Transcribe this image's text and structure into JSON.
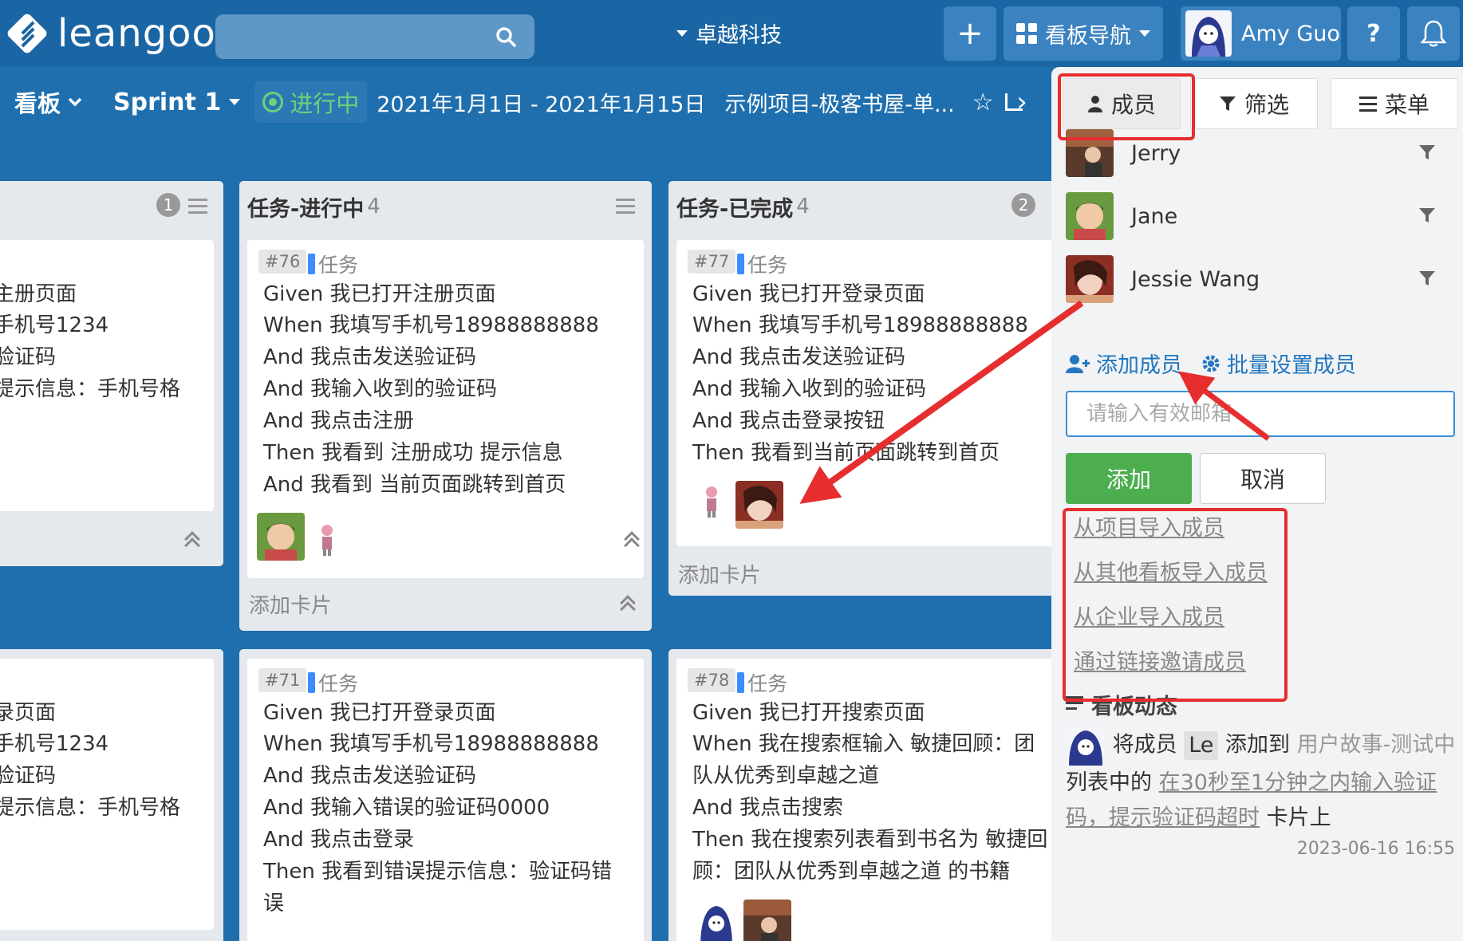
{
  "app": {
    "logo_text": "leangoo",
    "org_name": "卓越科技",
    "board_nav_label": "看板导航",
    "user_name": "Amy Guo",
    "help_label": "?"
  },
  "subheader": {
    "board_label": "看板",
    "sprint_label": "Sprint 1",
    "status_label": "进行中",
    "date_range": "2021年1月1日 - 2021年1月15日",
    "project_name": "示例项目-极客书屋-单..."
  },
  "lists": [
    {
      "title": "",
      "badge": "1",
      "cards": [
        {
          "lines": [
            "主册页面",
            "手机号1234",
            "验证码",
            "提示信息：手机号格"
          ]
        },
        {
          "lines": [
            "录页面",
            "手机号1234",
            "验证码",
            "提示信息：手机号格"
          ]
        }
      ]
    },
    {
      "title": "任务-进行中",
      "count": "4",
      "add_card": "添加卡片",
      "cards": [
        {
          "id": "#76",
          "type": "任务",
          "lines": [
            "Given 我已打开注册页面",
            "When 我填写手机号18988888888",
            "And 我点击发送验证码",
            "And 我输入收到的验证码",
            "And 我点击注册",
            "Then 我看到 注册成功 提示信息",
            "And 我看到 当前页面跳转到首页"
          ]
        },
        {
          "id": "#71",
          "type": "任务",
          "lines": [
            "Given 我已打开登录页面",
            "When 我填写手机号18988888888",
            "And 我点击发送验证码",
            "And 我输入错误的验证码0000",
            "And 我点击登录",
            "Then 我看到错误提示信息：验证码错",
            "误"
          ]
        }
      ]
    },
    {
      "title": "任务-已完成",
      "count": "4",
      "badge": "2",
      "add_card": "添加卡片",
      "cards": [
        {
          "id": "#77",
          "type": "任务",
          "lines": [
            "Given 我已打开登录页面",
            "When 我填写手机号18988888888",
            "And 我点击发送验证码",
            "And 我输入收到的验证码",
            "And 我点击登录按钮",
            "Then 我看到当前页面跳转到首页"
          ]
        },
        {
          "id": "#78",
          "type": "任务",
          "lines": [
            "Given 我已打开搜索页面",
            "When 我在搜索框输入 敏捷回顾：团",
            "队从优秀到卓越之道",
            "And 我点击搜索",
            "Then 我在搜索列表看到书名为 敏捷回",
            "顾：团队从优秀到卓越之道 的书籍"
          ]
        }
      ]
    }
  ],
  "panel": {
    "tabs": {
      "members": "成员",
      "filter": "筛选",
      "menu": "菜单"
    },
    "members": [
      {
        "name": "Jerry"
      },
      {
        "name": "Jane"
      },
      {
        "name": "Jessie Wang"
      }
    ],
    "add_member_label": "添加成员",
    "batch_setting_label": "批量设置成员",
    "email_placeholder": "请输入有效邮箱",
    "add_button": "添加",
    "cancel_button": "取消",
    "import_links": [
      "从项目导入成员",
      "从其他看板导入成员",
      "从企业导入成员",
      "通过链接邀请成员"
    ],
    "activity": {
      "title": "看板动态",
      "text_1": "将成员",
      "member_tag": "Le",
      "text_2": "添加到",
      "list_name": "用户故事-测试中",
      "text_3": "列表中的",
      "card_title": "在30秒至1分钟之内输入验证码，提示验证码超时",
      "text_4": "卡片上",
      "time": "2023-06-16 16:55"
    }
  },
  "colors": {
    "background": "#1f6fae",
    "topbar": "#1a65a3",
    "status_green": "#6dd07a",
    "add_button": "#4cae4f",
    "annotation_red": "#e62e2e",
    "link_blue": "#2477c0"
  }
}
